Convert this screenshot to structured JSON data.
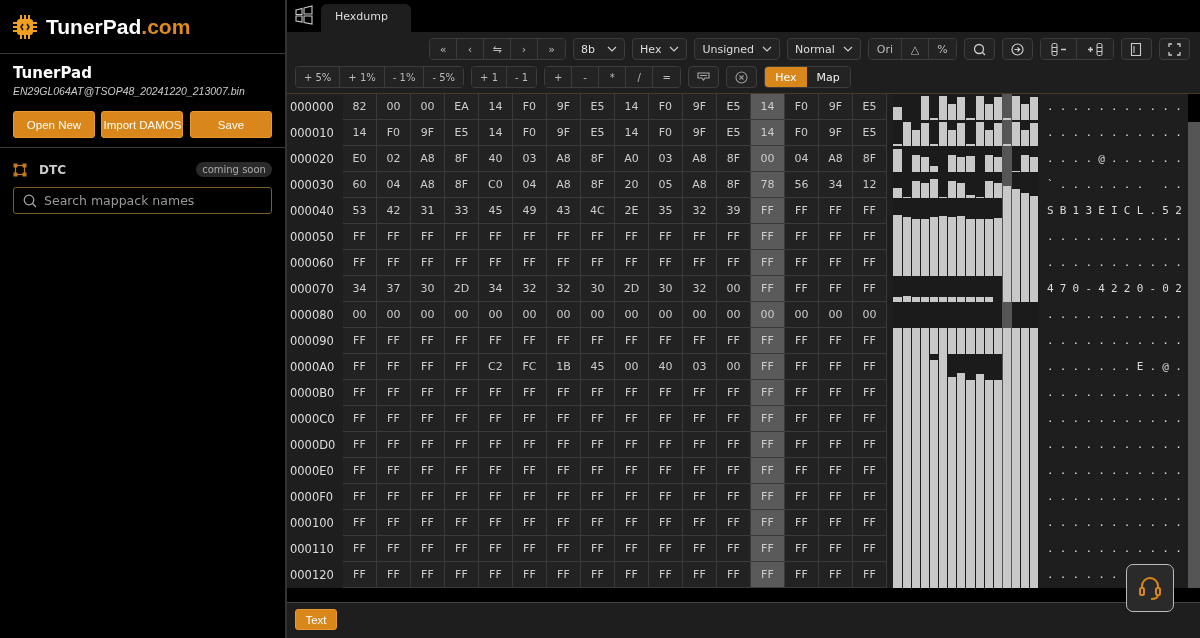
{
  "sidebar": {
    "logo": {
      "name": "TunerPad",
      "suffix": ".com"
    },
    "project": {
      "title": "TunerPad",
      "filename": "EN29GL064AT@TSOP48_20241220_213007.bin"
    },
    "buttons": [
      "Open New",
      "Import DAMOS",
      "Save"
    ],
    "dtc": {
      "label": "DTC",
      "badge": "coming soon"
    },
    "search": {
      "placeholder": "Search mappack names"
    }
  },
  "tabs": [
    {
      "label": "Hexdump",
      "selected": true
    }
  ],
  "toolbar_rows": [
    [
      {
        "kind": "group",
        "buttons": [
          {
            "label": "«"
          },
          {
            "label": "‹"
          },
          {
            "label": "⇋"
          },
          {
            "label": "›"
          },
          {
            "label": "»"
          }
        ]
      },
      {
        "kind": "dropdown",
        "value": "8b"
      },
      {
        "kind": "dropdown",
        "value": "Hex"
      },
      {
        "kind": "dropdown",
        "value": "Unsigned"
      },
      {
        "kind": "dropdown",
        "value": "Normal"
      },
      {
        "kind": "group",
        "buttons": [
          {
            "label": "Ori"
          },
          {
            "label": "△"
          },
          {
            "label": "%"
          }
        ]
      },
      {
        "kind": "search"
      },
      {
        "kind": "goto"
      },
      {
        "kind": "columns"
      },
      {
        "kind": "notes"
      },
      {
        "kind": "expand"
      }
    ],
    [
      {
        "kind": "group",
        "buttons": [
          {
            "label": "+ 5%"
          },
          {
            "label": "+ 1%"
          },
          {
            "label": "- 1%"
          },
          {
            "label": "- 5%"
          }
        ]
      },
      {
        "kind": "group",
        "buttons": [
          {
            "label": "+ 1"
          },
          {
            "label": "- 1"
          }
        ]
      },
      {
        "kind": "group",
        "buttons": [
          {
            "label": "+"
          },
          {
            "label": "-"
          },
          {
            "label": "*"
          },
          {
            "label": "/"
          },
          {
            "label": "="
          }
        ]
      },
      {
        "kind": "tag"
      },
      {
        "kind": "clear"
      },
      {
        "kind": "toggle",
        "options": [
          {
            "label": "Hex",
            "selected": true
          },
          {
            "label": "Map",
            "selected": false
          }
        ]
      }
    ]
  ],
  "hexdump": {
    "columns": [
      {
        "selected": false
      },
      {
        "selected": false
      },
      {
        "selected": false
      },
      {
        "selected": false
      },
      {
        "selected": false
      },
      {
        "selected": false
      },
      {
        "selected": false
      },
      {
        "selected": false
      },
      {
        "selected": false
      },
      {
        "selected": false
      },
      {
        "selected": false
      },
      {
        "selected": false
      },
      {
        "selected": true
      },
      {
        "selected": false
      },
      {
        "selected": false
      },
      {
        "selected": false
      }
    ],
    "rows": [
      {
        "address": "000000",
        "bytes": [
          "82",
          "00",
          "00",
          "EA",
          "14",
          "F0",
          "9F",
          "E5",
          "14",
          "F0",
          "9F",
          "E5",
          "14",
          "F0",
          "9F",
          "E5"
        ],
        "ascii": "..........."
      },
      {
        "address": "000010",
        "bytes": [
          "14",
          "F0",
          "9F",
          "E5",
          "14",
          "F0",
          "9F",
          "E5",
          "14",
          "F0",
          "9F",
          "E5",
          "14",
          "F0",
          "9F",
          "E5"
        ],
        "ascii": "..........."
      },
      {
        "address": "000020",
        "bytes": [
          "E0",
          "02",
          "A8",
          "8F",
          "40",
          "03",
          "A8",
          "8F",
          "A0",
          "03",
          "A8",
          "8F",
          "00",
          "04",
          "A8",
          "8F"
        ],
        "ascii": "....@......"
      },
      {
        "address": "000030",
        "bytes": [
          "60",
          "04",
          "A8",
          "8F",
          "C0",
          "04",
          "A8",
          "8F",
          "20",
          "05",
          "A8",
          "8F",
          "78",
          "56",
          "34",
          "12"
        ],
        "ascii": "`....... .."
      },
      {
        "address": "000040",
        "bytes": [
          "53",
          "42",
          "31",
          "33",
          "45",
          "49",
          "43",
          "4C",
          "2E",
          "35",
          "32",
          "39",
          "FF",
          "FF",
          "FF",
          "FF"
        ],
        "ascii": "SB13EICL.52"
      },
      {
        "address": "000050",
        "bytes": [
          "FF",
          "FF",
          "FF",
          "FF",
          "FF",
          "FF",
          "FF",
          "FF",
          "FF",
          "FF",
          "FF",
          "FF",
          "FF",
          "FF",
          "FF",
          "FF"
        ],
        "ascii": "..........."
      },
      {
        "address": "000060",
        "bytes": [
          "FF",
          "FF",
          "FF",
          "FF",
          "FF",
          "FF",
          "FF",
          "FF",
          "FF",
          "FF",
          "FF",
          "FF",
          "FF",
          "FF",
          "FF",
          "FF"
        ],
        "ascii": "..........."
      },
      {
        "address": "000070",
        "bytes": [
          "34",
          "37",
          "30",
          "2D",
          "34",
          "32",
          "32",
          "30",
          "2D",
          "30",
          "32",
          "00",
          "FF",
          "FF",
          "FF",
          "FF"
        ],
        "ascii": "470-4220-02"
      },
      {
        "address": "000080",
        "bytes": [
          "00",
          "00",
          "00",
          "00",
          "00",
          "00",
          "00",
          "00",
          "00",
          "00",
          "00",
          "00",
          "00",
          "00",
          "00",
          "00"
        ],
        "ascii": "..........."
      },
      {
        "address": "000090",
        "bytes": [
          "FF",
          "FF",
          "FF",
          "FF",
          "FF",
          "FF",
          "FF",
          "FF",
          "FF",
          "FF",
          "FF",
          "FF",
          "FF",
          "FF",
          "FF",
          "FF"
        ],
        "ascii": "..........."
      },
      {
        "address": "0000A0",
        "bytes": [
          "FF",
          "FF",
          "FF",
          "FF",
          "C2",
          "FC",
          "1B",
          "45",
          "00",
          "40",
          "03",
          "00",
          "FF",
          "FF",
          "FF",
          "FF"
        ],
        "ascii": ".......E.@."
      },
      {
        "address": "0000B0",
        "bytes": [
          "FF",
          "FF",
          "FF",
          "FF",
          "FF",
          "FF",
          "FF",
          "FF",
          "FF",
          "FF",
          "FF",
          "FF",
          "FF",
          "FF",
          "FF",
          "FF"
        ],
        "ascii": "..........."
      },
      {
        "address": "0000C0",
        "bytes": [
          "FF",
          "FF",
          "FF",
          "FF",
          "FF",
          "FF",
          "FF",
          "FF",
          "FF",
          "FF",
          "FF",
          "FF",
          "FF",
          "FF",
          "FF",
          "FF"
        ],
        "ascii": "..........."
      },
      {
        "address": "0000D0",
        "bytes": [
          "FF",
          "FF",
          "FF",
          "FF",
          "FF",
          "FF",
          "FF",
          "FF",
          "FF",
          "FF",
          "FF",
          "FF",
          "FF",
          "FF",
          "FF",
          "FF"
        ],
        "ascii": "..........."
      },
      {
        "address": "0000E0",
        "bytes": [
          "FF",
          "FF",
          "FF",
          "FF",
          "FF",
          "FF",
          "FF",
          "FF",
          "FF",
          "FF",
          "FF",
          "FF",
          "FF",
          "FF",
          "FF",
          "FF"
        ],
        "ascii": "..........."
      },
      {
        "address": "0000F0",
        "bytes": [
          "FF",
          "FF",
          "FF",
          "FF",
          "FF",
          "FF",
          "FF",
          "FF",
          "FF",
          "FF",
          "FF",
          "FF",
          "FF",
          "FF",
          "FF",
          "FF"
        ],
        "ascii": "..........."
      },
      {
        "address": "000100",
        "bytes": [
          "FF",
          "FF",
          "FF",
          "FF",
          "FF",
          "FF",
          "FF",
          "FF",
          "FF",
          "FF",
          "FF",
          "FF",
          "FF",
          "FF",
          "FF",
          "FF"
        ],
        "ascii": "..........."
      },
      {
        "address": "000110",
        "bytes": [
          "FF",
          "FF",
          "FF",
          "FF",
          "FF",
          "FF",
          "FF",
          "FF",
          "FF",
          "FF",
          "FF",
          "FF",
          "FF",
          "FF",
          "FF",
          "FF"
        ],
        "ascii": "..........."
      },
      {
        "address": "000120",
        "bytes": [
          "FF",
          "FF",
          "FF",
          "FF",
          "FF",
          "FF",
          "FF",
          "FF",
          "FF",
          "FF",
          "FF",
          "FF",
          "FF",
          "FF",
          "FF",
          "FF"
        ],
        "ascii": "......"
      }
    ]
  },
  "footer": {
    "button": "Text"
  }
}
